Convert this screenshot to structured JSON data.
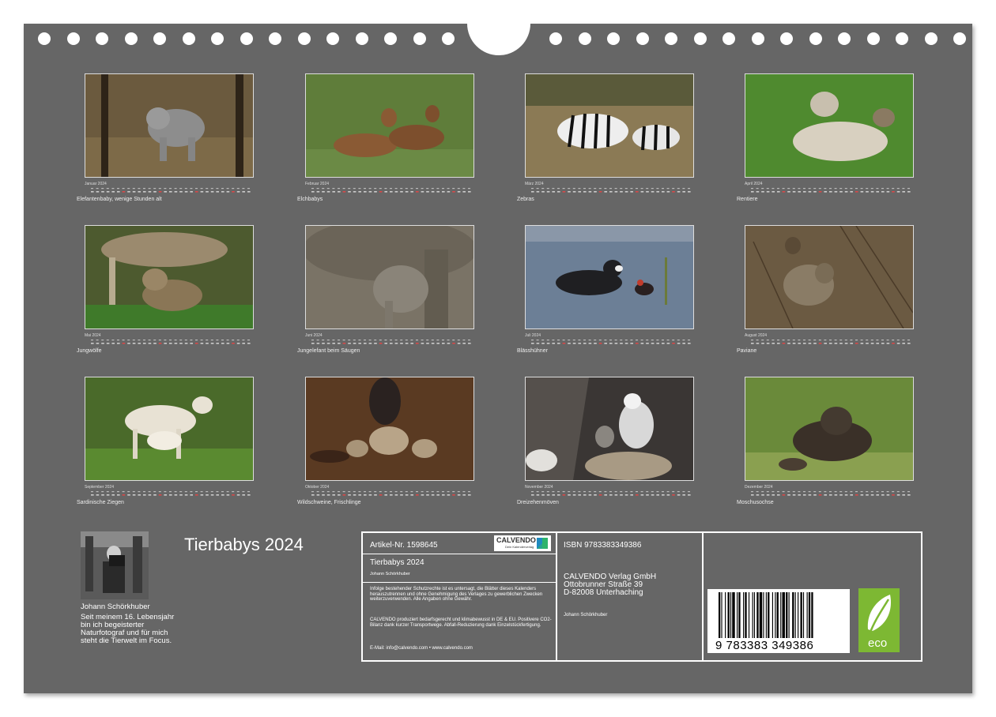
{
  "months": [
    {
      "name": "Januar 2024",
      "caption": "Elefantenbaby, wenige Stunden alt",
      "photo": "elephant-calf-photo"
    },
    {
      "name": "Februar 2024",
      "caption": "Elchbabys",
      "photo": "moose-calves-photo"
    },
    {
      "name": "März 2024",
      "caption": "Zebras",
      "photo": "zebras-photo"
    },
    {
      "name": "April 2024",
      "caption": "Rentiere",
      "photo": "reindeer-photo"
    },
    {
      "name": "Mai 2024",
      "caption": "Jungwölfe",
      "photo": "wolf-cubs-photo"
    },
    {
      "name": "Juni 2024",
      "caption": "Jungelefant beim Säugen",
      "photo": "elephant-nursing-photo"
    },
    {
      "name": "Juli 2024",
      "caption": "Blässhühner",
      "photo": "coots-photo"
    },
    {
      "name": "August 2024",
      "caption": "Paviane",
      "photo": "baboons-photo"
    },
    {
      "name": "September 2024",
      "caption": "Sardinische Ziegen",
      "photo": "goats-photo"
    },
    {
      "name": "Oktober 2024",
      "caption": "Wildschweine, Frischlinge",
      "photo": "wild-boars-photo"
    },
    {
      "name": "November 2024",
      "caption": "Dreizehenmöven",
      "photo": "kittiwakes-photo"
    },
    {
      "name": "Dezember 2024",
      "caption": "Moschusochse",
      "photo": "muskox-photo"
    }
  ],
  "cover": {
    "title": "Tierbabys 2024"
  },
  "author": {
    "name": "Johann Schörkhuber",
    "bio": "Seit meinem 16. Lebensjahr bin ich begeisterter Naturfotograf und für mich steht die Tierwelt im Focus."
  },
  "info": {
    "article": "Artikel-Nr. 1598645",
    "logo_text": "CALVENDO",
    "logo_sub": "Dein Kalenderverlag",
    "title": "Tierbabys 2024",
    "author": "Johann Schörkhuber",
    "notice": "Infolge bestehender Schutzrechte ist es untersagt, die Blätter dieses Kalenders herauszutrennen und ohne Genehmigung des Verlages zu gewerblichen Zwecken weiterzuverwenden. Alle Angaben ohne Gewähr.",
    "eco_notice": "CALVENDO produziert bedarfsgerecht und klimabewusst in DE & EU. Positivere CO2-Bilanz dank kurzer Transportwege. Abfall-Reduzierung dank Einzelstückfertigung.",
    "contact": "E-Mail: info@calvendo.com • www.calvendo.com",
    "isbn": "ISBN 9783383349386",
    "publisher_name": "CALVENDO Verlag GmbH",
    "publisher_street": "Ottobrunner Straße 39",
    "publisher_city": "D-82008 Unterhaching",
    "publisher_author": "Johann Schörkhuber",
    "barcode_digits": "9 783383 349386",
    "eco_label": "eco"
  },
  "colors": {
    "sheet": "#666666",
    "text": "#ffffff",
    "eco_green": "#7db833"
  }
}
